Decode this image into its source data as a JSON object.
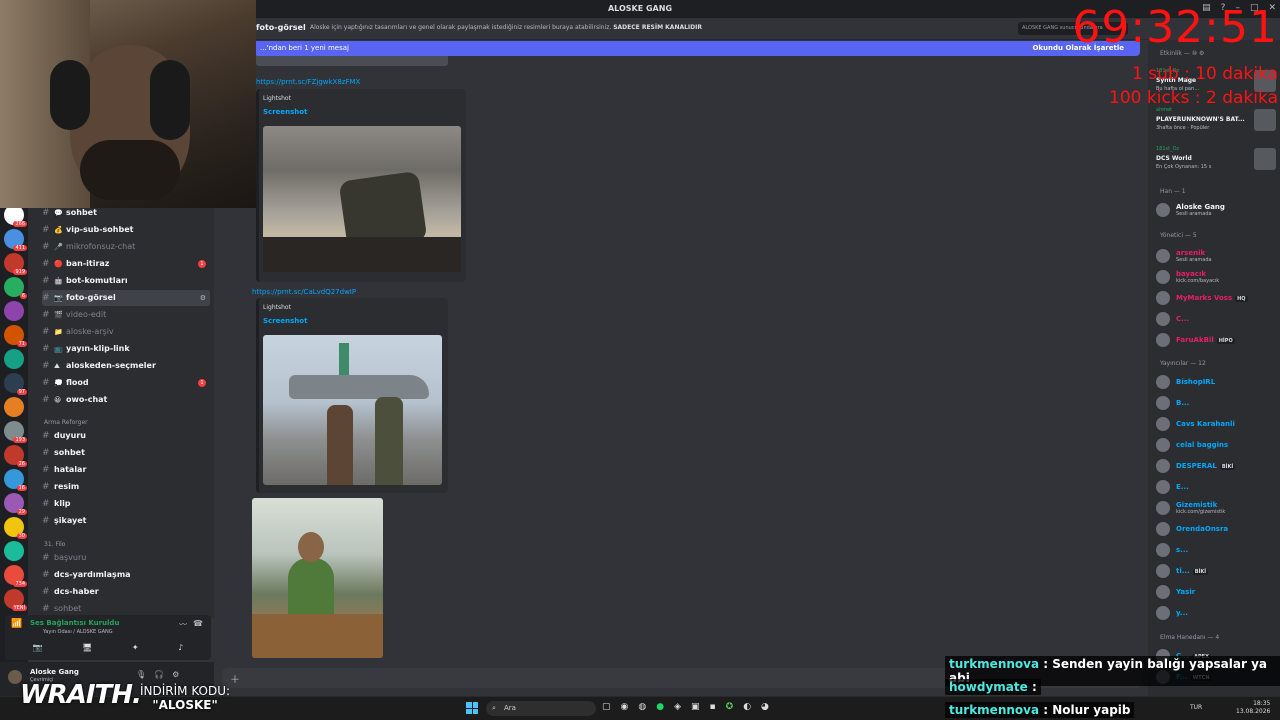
{
  "app": {
    "title": "ALOSKE GANG"
  },
  "header": {
    "channel": "foto-görsel",
    "topic": "Aloske için yaptığınız tasarımları ve genel olarak paylaşmak istediğiniz resimleri buraya atabilirsiniz.",
    "topic_bold": "SADECE RESİM KANALIDIR",
    "search_placeholder": "ALOSKE GANG sunucusunda ara"
  },
  "banner": {
    "text": "...'ndan beri 1 yeni mesaj",
    "right": "Okundu Olarak İşaretle"
  },
  "server_badges": [
    "266",
    "411",
    "919",
    "6",
    "",
    "71",
    "",
    "97",
    "",
    "193",
    "26",
    "16",
    "29",
    "30",
    "",
    "734",
    "YENİ"
  ],
  "channels": [
    {
      "emoji": "💬",
      "name": "sohbet",
      "muted": false,
      "badge": ""
    },
    {
      "emoji": "💰",
      "name": "vip-sub-sohbet",
      "muted": false,
      "badge": ""
    },
    {
      "emoji": "🎤",
      "name": "mikrofonsuz-chat",
      "muted": true,
      "badge": ""
    },
    {
      "emoji": "🔴",
      "name": "ban-itiraz",
      "muted": false,
      "badge": "1"
    },
    {
      "emoji": "🤖",
      "name": "bot-komutları",
      "muted": false,
      "badge": ""
    },
    {
      "emoji": "📷",
      "name": "foto-görsel",
      "muted": false,
      "badge": "",
      "active": true
    },
    {
      "emoji": "🎬",
      "name": "video-edit",
      "muted": true,
      "badge": ""
    },
    {
      "emoji": "📁",
      "name": "aloske-arşiv",
      "muted": true,
      "badge": ""
    },
    {
      "emoji": "📺",
      "name": "yayın-klip-link",
      "muted": false,
      "badge": ""
    },
    {
      "emoji": "⛰",
      "name": "aloskeden-seçmeler",
      "muted": false,
      "badge": ""
    },
    {
      "emoji": "💭",
      "name": "flood",
      "muted": false,
      "badge": "1"
    },
    {
      "emoji": "😀",
      "name": "owo-chat",
      "muted": false,
      "badge": ""
    }
  ],
  "category_arma": "Arma Reforger",
  "channels_arma": [
    "duyuru",
    "sohbet",
    "hatalar",
    "resim",
    "klip",
    "şikayet"
  ],
  "category_filo": "31. Filo",
  "channels_filo": [
    {
      "name": "başvuru",
      "muted": true
    },
    {
      "name": "dcs-yardımlaşma",
      "muted": false
    },
    {
      "name": "dcs-haber",
      "muted": false
    },
    {
      "name": "sohbet",
      "muted": true
    }
  ],
  "voice": {
    "status": "Ses Bağlantısı Kuruldu",
    "channel": "Yayın Odası / ALOSKE GANG"
  },
  "user": {
    "name": "Aloske Gang",
    "status": "Çevrimiçi"
  },
  "messages": {
    "link1": "https://prnt.sc/FZjgwkX8zFMX",
    "provider1": "Lightshot",
    "title1": "Screenshot",
    "link2": "https://prnt.sc/CaLvdQ27dwIP",
    "provider2": "Lightshot",
    "title2": "Screenshot"
  },
  "members": {
    "activity_header": "Etkinlik — ⑩ ⚙",
    "activities": [
      {
        "user": "181st_Oz",
        "title": "Synth Mage",
        "sub": "Bu hafta ol parı..."
      },
      {
        "user": "ahmet",
        "title": "PLAYERUNKNOWN'S BAT...",
        "sub": "3hafta önce · Popüler"
      },
      {
        "user": "181st_Oz",
        "title": "DCS World",
        "sub": "En Çok Oynanan: 15 s"
      }
    ],
    "han_header": "Han — 1",
    "han": [
      {
        "name": "Aloske Gang",
        "sub": "Sesli aramada",
        "color": "#f2f3f5"
      }
    ],
    "mod_header": "Yönetici — 5",
    "mods": [
      {
        "name": "arsenik",
        "sub": "Sesli aramada",
        "color": "#e91e63"
      },
      {
        "name": "bayacık",
        "sub": "kick.com/bayacık",
        "color": "#e91e63"
      },
      {
        "name": "MyMarks Voss",
        "sub": "",
        "color": "#e91e63",
        "tag": "HQ"
      },
      {
        "name": "C...",
        "sub": "",
        "color": "#e91e63"
      },
      {
        "name": "FaruAkBil",
        "sub": "",
        "color": "#e91e63",
        "tag": "HİPO"
      }
    ],
    "stream_header": "Yayıncılar — 12",
    "streamers": [
      {
        "name": "BishopIRL",
        "tag": "",
        "sub": ""
      },
      {
        "name": "B...",
        "tag": "",
        "sub": ""
      },
      {
        "name": "Cavs Karahanli",
        "tag": "",
        "sub": ""
      },
      {
        "name": "celal baggins",
        "tag": "",
        "sub": ""
      },
      {
        "name": "DESPERAL",
        "tag": "BİKİ",
        "sub": ""
      },
      {
        "name": "E...",
        "tag": "",
        "sub": ""
      },
      {
        "name": "Gizemistik",
        "tag": "",
        "sub": "kick.com/gizemistik"
      },
      {
        "name": "OrendaOnsra",
        "tag": "",
        "sub": ""
      },
      {
        "name": "s...",
        "tag": "",
        "sub": ""
      },
      {
        "name": "ti...",
        "tag": "BİKİ",
        "sub": ""
      },
      {
        "name": "Yasir",
        "tag": "",
        "sub": ""
      },
      {
        "name": "y...",
        "tag": "",
        "sub": ""
      }
    ],
    "elma_header": "Elma Hanedanı — 4",
    "elma": [
      {
        "name": "C...",
        "tag": "APEX"
      },
      {
        "name": "F...",
        "tag": "WTCN"
      }
    ]
  },
  "overlay": {
    "timer": "69:32:51",
    "line1": "1 sub : 10 dakika",
    "line2": "100 kicks : 2 dakika",
    "wraith": "WRAITH.",
    "promo1": "İNDİRİM KODU:",
    "promo2": "\"ALOSKE\""
  },
  "chat": [
    {
      "user": "turkmennova",
      "text": ": Senden yayin balığı yapsalar ya abi"
    },
    {
      "user": "howdymate",
      "text": ":"
    },
    {
      "user": "turkmennova",
      "text": ": Nolur yapib"
    }
  ],
  "taskbar": {
    "search": "Ara",
    "lang": "TUR",
    "time": "18:35",
    "date": "13.08.2026"
  },
  "colors": {
    "accent": "#5865f2",
    "timer": "#ff1212",
    "link": "#00a8fc"
  }
}
